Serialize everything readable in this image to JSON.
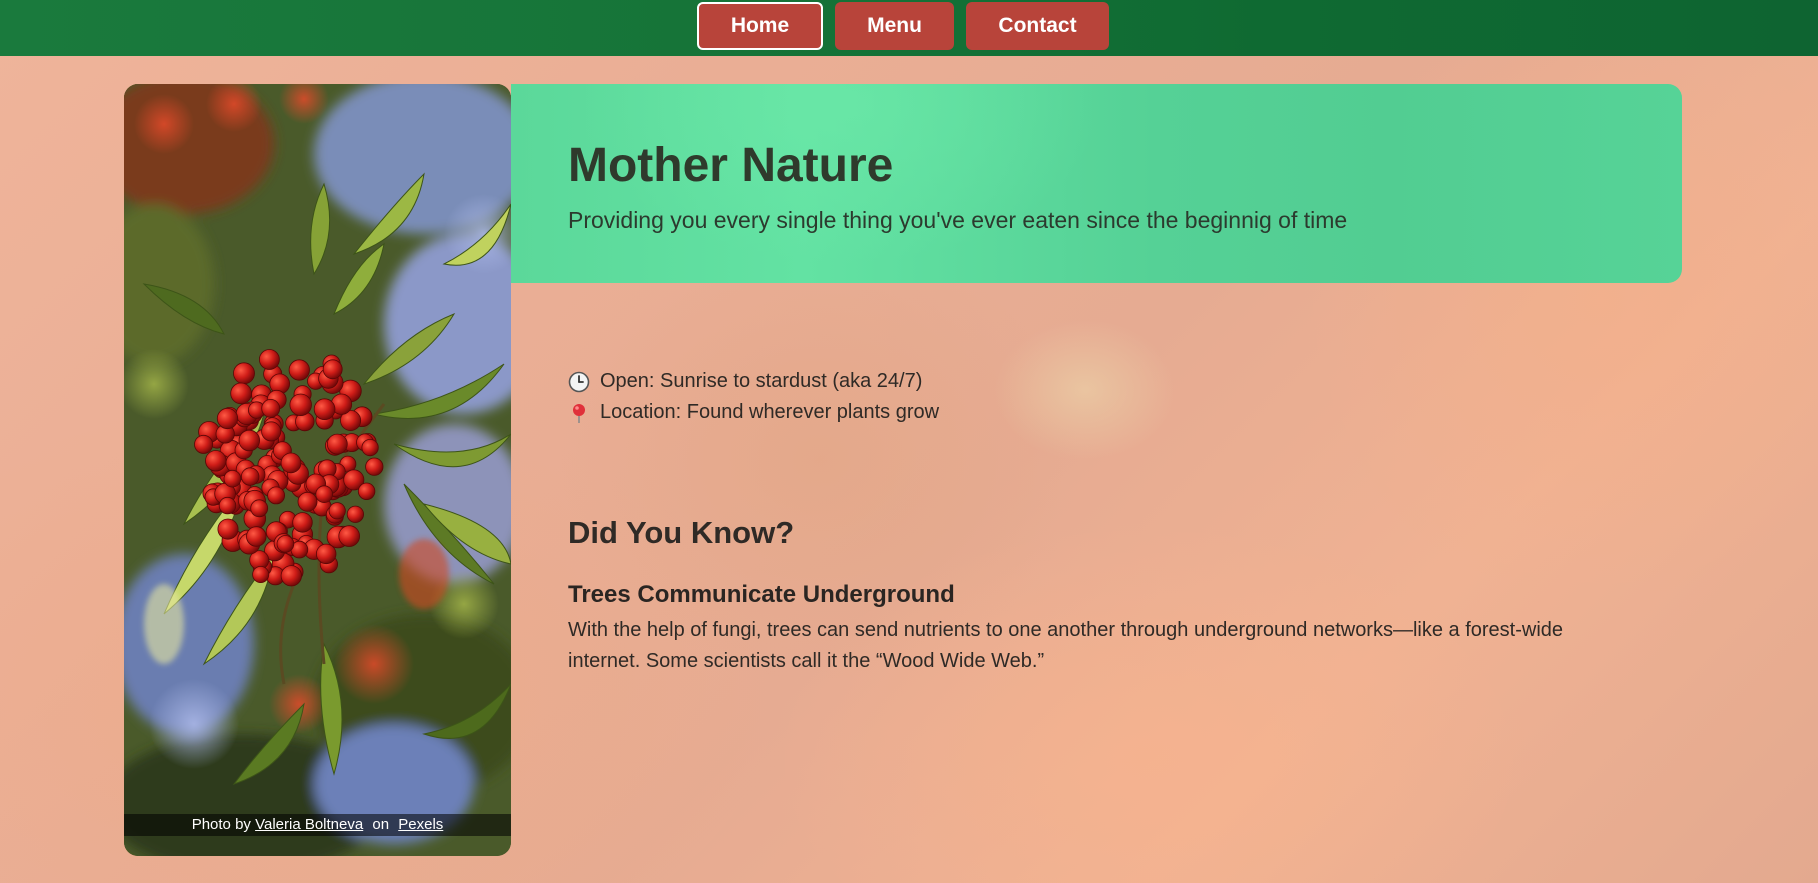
{
  "nav": {
    "items": [
      {
        "label": "Home",
        "active": true
      },
      {
        "label": "Menu",
        "active": false
      },
      {
        "label": "Contact",
        "active": false
      }
    ],
    "bar_color": "#167438",
    "button_color": "#b8443a"
  },
  "photo": {
    "subject": "rowan-berries-photo",
    "credit_prefix": "Photo by",
    "credit_author": "Valeria Boltneva",
    "credit_sep": "on",
    "credit_site": "Pexels"
  },
  "hero": {
    "title": "Mother Nature",
    "subtitle": "Providing you every single thing you've ever eaten since the beginnig of time",
    "color": "#5bd89a"
  },
  "info": {
    "hours_icon": "clock-icon",
    "hours": "Open: Sunrise to stardust (aka 24/7)",
    "location_icon": "pushpin-icon",
    "location": "Location: Found wherever plants grow"
  },
  "did_you_know": {
    "heading": "Did You Know?",
    "fact_title": "Trees Communicate Underground",
    "fact_body": "With the help of fungi, trees can send nutrients to one another through underground networks—like a forest-wide internet. Some scientists call it the “Wood Wide Web.”"
  }
}
